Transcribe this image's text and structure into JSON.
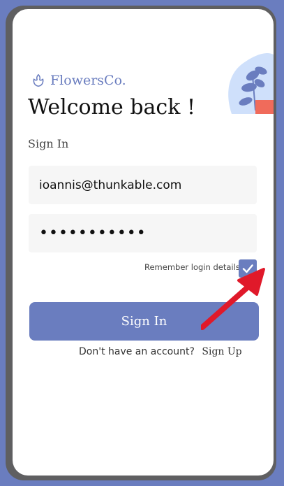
{
  "brand": {
    "name": "FlowersCo.",
    "logo_icon": "flower-icon",
    "color": "#6a7dbf"
  },
  "title": "Welcome back !",
  "section_label": "Sign In",
  "email_field": {
    "value": "ioannis@thunkable.com"
  },
  "password_field": {
    "value": "•••••••••••"
  },
  "remember": {
    "label": "Remember login details",
    "checked": true
  },
  "signin_button": {
    "label": "Sign In"
  },
  "signup": {
    "prompt": "Don't have an account?",
    "link_label": "Sign Up"
  },
  "colors": {
    "accent": "#6a7dbf",
    "frame": "#5f5f61",
    "annotation": "#e0192a"
  }
}
